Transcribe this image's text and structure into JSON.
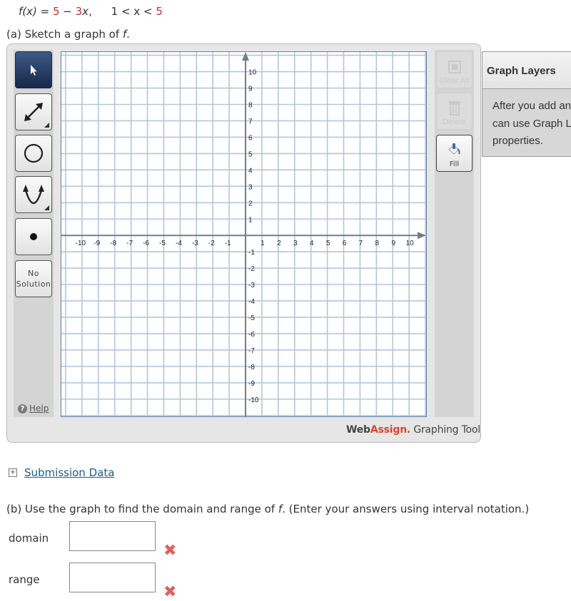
{
  "question": {
    "func_prefix": "f(x) = ",
    "func_a": "5",
    "func_minus": " − ",
    "func_b": "3",
    "func_var": "x",
    "func_comma": ",",
    "domain_left": "1 < x < ",
    "domain_right": "5",
    "part_a": "(a) Sketch a graph of ",
    "part_a_f": "f",
    "part_a_end": "."
  },
  "tools": {
    "items": [
      {
        "name": "select",
        "icon": "pointer-arrow-icon",
        "active": true
      },
      {
        "name": "line",
        "icon": "line-arrows-icon",
        "active": false
      },
      {
        "name": "circle",
        "icon": "circle-icon",
        "active": false
      },
      {
        "name": "parabola",
        "icon": "parabola-icon",
        "active": false
      },
      {
        "name": "point",
        "icon": "point-icon",
        "active": false
      }
    ],
    "no_solution_line1": "No",
    "no_solution_line2": "Solution",
    "help_label": "Help"
  },
  "side_buttons": {
    "clear_all": "Clear All",
    "delete": "Delete",
    "fill": "Fill"
  },
  "graph": {
    "x_ticks": [
      -10,
      -9,
      -8,
      -7,
      -6,
      -5,
      -4,
      -3,
      -2,
      -1,
      1,
      2,
      3,
      4,
      5,
      6,
      7,
      8,
      9,
      10
    ],
    "y_ticks": [
      10,
      9,
      8,
      7,
      6,
      5,
      4,
      3,
      2,
      1,
      -1,
      -2,
      -3,
      -4,
      -5,
      -6,
      -7,
      -8,
      -9,
      -10
    ],
    "x_range": [
      -11.26,
      11.04
    ],
    "y_range": [
      -11.05,
      11.2
    ],
    "grid_color": "#b3c6dc",
    "axis_color": "#6e7e8e"
  },
  "brand": {
    "web": "Web",
    "assign": "Assign.",
    "tool": " Graphing Tool"
  },
  "layers": {
    "title": "Graph Layers",
    "body_line1": "After you add an object to the graph you",
    "body_line2": "can use Graph Layers to view and edit its",
    "body_line3": "properties."
  },
  "submission": {
    "label": "Submission Data"
  },
  "part_b": {
    "prefix": "(b) Use the graph to find the domain and range of ",
    "f": "f",
    "suffix": ". (Enter your answers using interval notation.)",
    "domain_label": "domain",
    "domain_value": "",
    "range_label": "range",
    "range_value": ""
  },
  "colors": {
    "accent_red": "#c4322a",
    "link_blue": "#1d5a8a",
    "active_tool": "#1c2b47"
  }
}
